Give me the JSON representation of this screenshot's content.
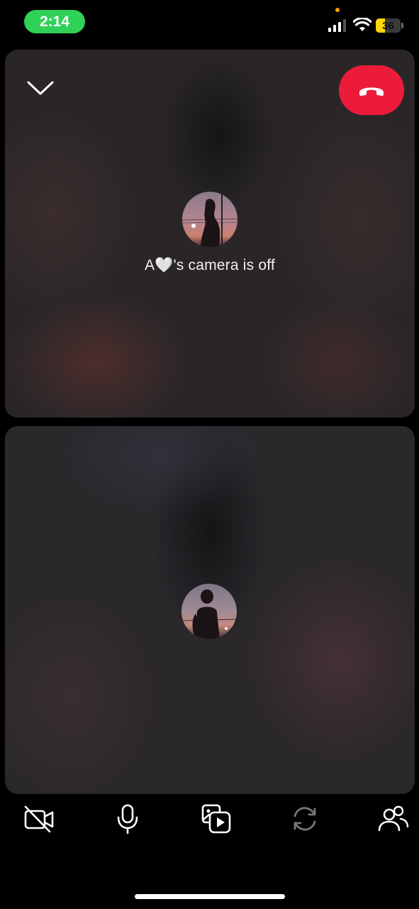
{
  "status_bar": {
    "time": "2:14",
    "battery_level": "36",
    "battery_fraction": 0.36,
    "time_pill_color": "#30d158",
    "battery_color": "#ffd60a"
  },
  "call": {
    "end_call_color": "#ed1b3a",
    "remote_participant": {
      "camera_off_text": "A🤍's camera is off"
    }
  },
  "controls": {
    "items": [
      {
        "name": "camera-off-icon"
      },
      {
        "name": "microphone-icon"
      },
      {
        "name": "media-share-icon"
      },
      {
        "name": "flip-camera-icon"
      },
      {
        "name": "participants-icon"
      }
    ]
  }
}
